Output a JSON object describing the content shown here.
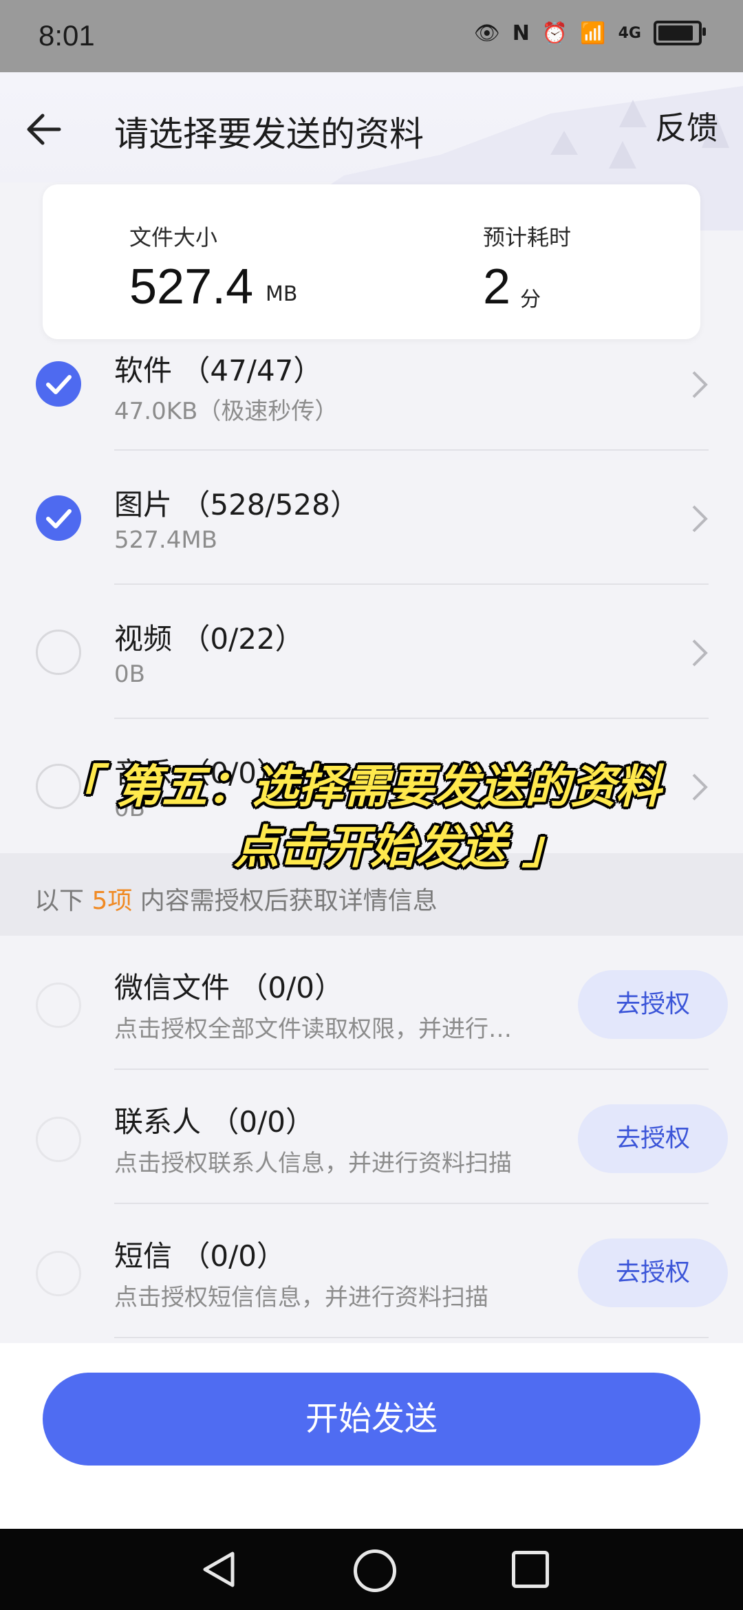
{
  "status_bar": {
    "time": "8:01",
    "network": "4G"
  },
  "header": {
    "title": "请选择要发送的资料",
    "feedback": "反馈"
  },
  "summary": {
    "size_label": "文件大小",
    "size_value": "527.4",
    "size_unit": "MB",
    "time_label": "预计耗时",
    "time_value": "2",
    "time_unit": "分"
  },
  "items": [
    {
      "title": "软件 （47/47）",
      "subtitle": "47.0KB（极速秒传）",
      "checked": true
    },
    {
      "title": "图片 （528/528）",
      "subtitle": "527.4MB",
      "checked": true
    },
    {
      "title": "视频 （0/22）",
      "subtitle": "0B",
      "checked": false
    },
    {
      "title": "音乐 （0/0）",
      "subtitle": "0B",
      "checked": false
    }
  ],
  "auth_banner": {
    "prefix": "以下 ",
    "count": "5项",
    "suffix": " 内容需授权后获取详情信息"
  },
  "auth_items": [
    {
      "title": "微信文件 （0/0）",
      "subtitle": "点击授权全部文件读取权限，并进行…",
      "button": "去授权"
    },
    {
      "title": "联系人 （0/0）",
      "subtitle": "点击授权联系人信息，并进行资料扫描",
      "button": "去授权"
    },
    {
      "title": "短信 （0/0）",
      "subtitle": "点击授权短信信息，并进行资料扫描",
      "button": "去授权"
    }
  ],
  "start_button": "开始发送",
  "overlay": {
    "line1": "「 第五：选择需要发送的资料",
    "line2": "点击开始发送 」"
  },
  "colors": {
    "accent": "#4f6cf2",
    "highlight": "#f08a24",
    "overlay_text": "#ffe94d"
  }
}
